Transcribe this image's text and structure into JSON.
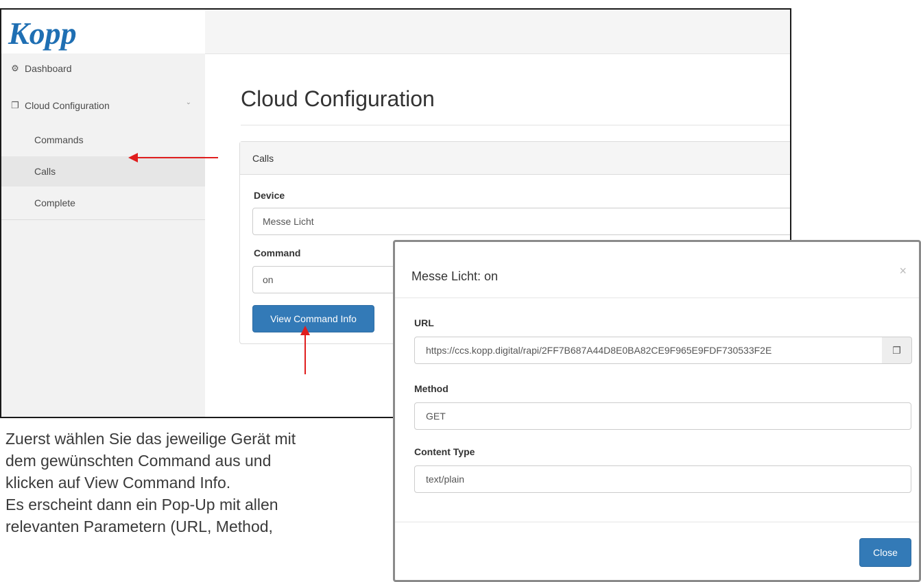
{
  "logo_text": "Kopp",
  "sidebar": {
    "dashboard": "Dashboard",
    "cloud_configuration": "Cloud Configuration",
    "sub_items": [
      "Commands",
      "Calls",
      "Complete"
    ]
  },
  "main": {
    "page_title": "Cloud Configuration",
    "panel_heading": "Calls",
    "device_label": "Device",
    "device_value": "Messe Licht",
    "command_label": "Command",
    "command_value": "on",
    "view_button": "View Command Info"
  },
  "modal": {
    "title": "Messe Licht: on",
    "close_x": "×",
    "url_label": "URL",
    "url_value": "https://ccs.kopp.digital/rapi/2FF7B687A44D8E0BA82CE9F965E9FDF730533F2E",
    "method_label": "Method",
    "method_value": "GET",
    "content_type_label": "Content Type",
    "content_type_value": "text/plain",
    "close_button": "Close"
  },
  "caption": [
    "Zuerst wählen Sie das jeweilige Gerät mit",
    "dem gewünschten Command aus und",
    "klicken auf View Command Info.",
    "Es erscheint dann ein Pop-Up mit allen",
    "relevanten Parametern (URL, Method,"
  ],
  "colors": {
    "primary": "#337ab7",
    "logo": "#1f6fb3",
    "arrow": "#e01d1d"
  }
}
